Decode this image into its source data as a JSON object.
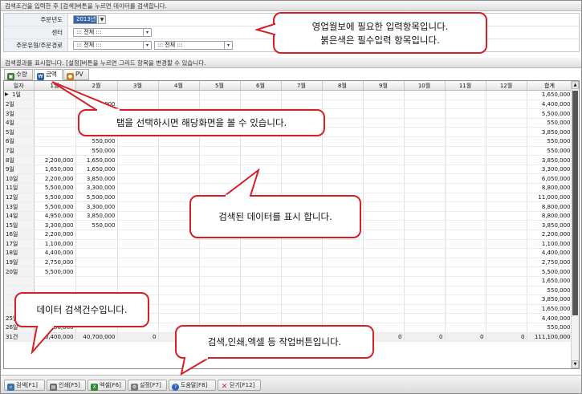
{
  "search_bar": {
    "hint": "검색조건을 입력한 후 [검색]버튼을 누르면 데이터를 검색합니다."
  },
  "criteria": {
    "order_year": {
      "label": "주문년도",
      "value": "2013년"
    },
    "center": {
      "label": "센터",
      "value": "::: 전체 :::"
    },
    "order_type": {
      "label": "주문유형/주문경로",
      "value1": "::: 전체 :::",
      "value2": "::: 전체 :::"
    }
  },
  "result_bar": {
    "hint": "검색결과를 표시합니다. [설정]버튼을 누르면 그리드 항목을 변경할 수 있습니다."
  },
  "tabs": [
    {
      "label": "수량",
      "icon": "package-icon",
      "color": "#3a7d32"
    },
    {
      "label": "금액",
      "icon": "money-icon",
      "color": "#2a5ea8"
    },
    {
      "label": "PV",
      "icon": "coin-icon",
      "color": "#d17a1a"
    }
  ],
  "grid": {
    "headers": [
      "일자",
      "1월",
      "2월",
      "3월",
      "4월",
      "5월",
      "6월",
      "7월",
      "8월",
      "9월",
      "10월",
      "11월",
      "12월",
      "합계"
    ],
    "rows": [
      [
        "1일",
        "",
        "",
        "",
        "",
        "",
        "",
        "",
        "",
        "",
        "",
        "",
        "",
        "1,650,000"
      ],
      [
        "2일",
        "",
        "4,400,000",
        "",
        "",
        "",
        "",
        "",
        "",
        "",
        "",
        "",
        "",
        "4,400,000"
      ],
      [
        "3일",
        "",
        "",
        "",
        "",
        "",
        "",
        "",
        "",
        "",
        "",
        "",
        "",
        "5,500,000"
      ],
      [
        "4일",
        "",
        "",
        "",
        "",
        "",
        "",
        "",
        "",
        "",
        "",
        "",
        "",
        "550,000"
      ],
      [
        "5일",
        "",
        "3,850,000",
        "",
        "",
        "",
        "",
        "",
        "",
        "",
        "",
        "",
        "",
        "3,850,000"
      ],
      [
        "6일",
        "",
        "550,000",
        "",
        "",
        "",
        "",
        "",
        "",
        "",
        "",
        "",
        "",
        "550,000"
      ],
      [
        "7일",
        "",
        "550,000",
        "",
        "",
        "",
        "",
        "",
        "",
        "",
        "",
        "",
        "",
        "550,000"
      ],
      [
        "8일",
        "2,200,000",
        "1,650,000",
        "",
        "",
        "",
        "",
        "",
        "",
        "",
        "",
        "",
        "",
        "3,850,000"
      ],
      [
        "9일",
        "1,650,000",
        "1,650,000",
        "",
        "",
        "",
        "",
        "",
        "",
        "",
        "",
        "",
        "",
        "3,300,000"
      ],
      [
        "10일",
        "2,200,000",
        "3,850,000",
        "",
        "",
        "",
        "",
        "",
        "",
        "",
        "",
        "",
        "",
        "6,050,000"
      ],
      [
        "11일",
        "5,500,000",
        "3,300,000",
        "",
        "",
        "",
        "",
        "",
        "",
        "",
        "",
        "",
        "",
        "8,800,000"
      ],
      [
        "12일",
        "5,500,000",
        "5,500,000",
        "",
        "",
        "",
        "",
        "",
        "",
        "",
        "",
        "",
        "",
        "11,000,000"
      ],
      [
        "13일",
        "5,500,000",
        "3,300,000",
        "",
        "",
        "",
        "",
        "",
        "",
        "",
        "",
        "",
        "",
        "8,800,000"
      ],
      [
        "14일",
        "4,950,000",
        "3,850,000",
        "",
        "",
        "",
        "",
        "",
        "",
        "",
        "",
        "",
        "",
        "8,800,000"
      ],
      [
        "15일",
        "3,300,000",
        "550,000",
        "",
        "",
        "",
        "",
        "",
        "",
        "",
        "",
        "",
        "",
        "3,850,000"
      ],
      [
        "16일",
        "2,200,000",
        "",
        "",
        "",
        "",
        "",
        "",
        "",
        "",
        "",
        "",
        "",
        "2,200,000"
      ],
      [
        "17일",
        "1,100,000",
        "",
        "",
        "",
        "",
        "",
        "",
        "",
        "",
        "",
        "",
        "",
        "1,100,000"
      ],
      [
        "18일",
        "4,400,000",
        "",
        "",
        "",
        "",
        "",
        "",
        "",
        "",
        "",
        "",
        "",
        "4,400,000"
      ],
      [
        "19일",
        "2,750,000",
        "",
        "",
        "",
        "",
        "",
        "",
        "",
        "",
        "",
        "",
        "",
        "2,750,000"
      ],
      [
        "20일",
        "5,500,000",
        "",
        "",
        "",
        "",
        "",
        "",
        "",
        "",
        "",
        "",
        "",
        "5,500,000"
      ],
      [
        "",
        "",
        "",
        "",
        "",
        "",
        "",
        "",
        "",
        "",
        "",
        "",
        "",
        "1,650,000"
      ],
      [
        "",
        "",
        "",
        "",
        "",
        "",
        "",
        "",
        "",
        "",
        "",
        "",
        "",
        "550,000"
      ],
      [
        "",
        "",
        "",
        "",
        "",
        "",
        "",
        "",
        "",
        "",
        "",
        "",
        "",
        "3,850,000"
      ],
      [
        "",
        "",
        "",
        "",
        "",
        "",
        "",
        "",
        "",
        "",
        "",
        "",
        "",
        "1,650,000"
      ],
      [
        "25일",
        "",
        "",
        "",
        "",
        "",
        "",
        "",
        "",
        "",
        "",
        "",
        "",
        "4,400,000"
      ],
      [
        "26일",
        "550,000",
        "",
        "",
        "",
        "",
        "",
        "",
        "",
        "",
        "",
        "",
        "",
        "550,000"
      ]
    ],
    "footer": [
      "31건",
      "70,400,000",
      "40,700,000",
      "0",
      "0",
      "0",
      "0",
      "0",
      "0",
      "0",
      "0",
      "0",
      "0",
      "111,100,000"
    ]
  },
  "buttons": [
    {
      "label": "검색[F1]",
      "icon": "search-icon",
      "color": "#3a6fb0"
    },
    {
      "label": "인쇄[F5]",
      "icon": "printer-icon",
      "color": "#6b6b6b"
    },
    {
      "label": "엑셀[F6]",
      "icon": "excel-icon",
      "color": "#2e8b3a"
    },
    {
      "label": "설정[F7]",
      "icon": "gear-icon",
      "color": "#7a7a7a"
    },
    {
      "label": "도움말[F8]",
      "icon": "help-icon",
      "color": "#2f63b8"
    },
    {
      "label": "닫기[F12]",
      "icon": "close-icon",
      "color": "#cc2222"
    }
  ],
  "callouts": {
    "criteria": "영업월보에  필요한 입력항목입니다.\n붉은색은 필수입력 항목입니다.",
    "tabs": "탭을 선택하시면  해당화면을 볼 수 있습니다.",
    "data": "검색된 데이터를 표시 합니다.",
    "count": "데이터 검색건수입니다.",
    "buttons": "검색,인쇄,엑셀 등 작업버튼입니다."
  }
}
